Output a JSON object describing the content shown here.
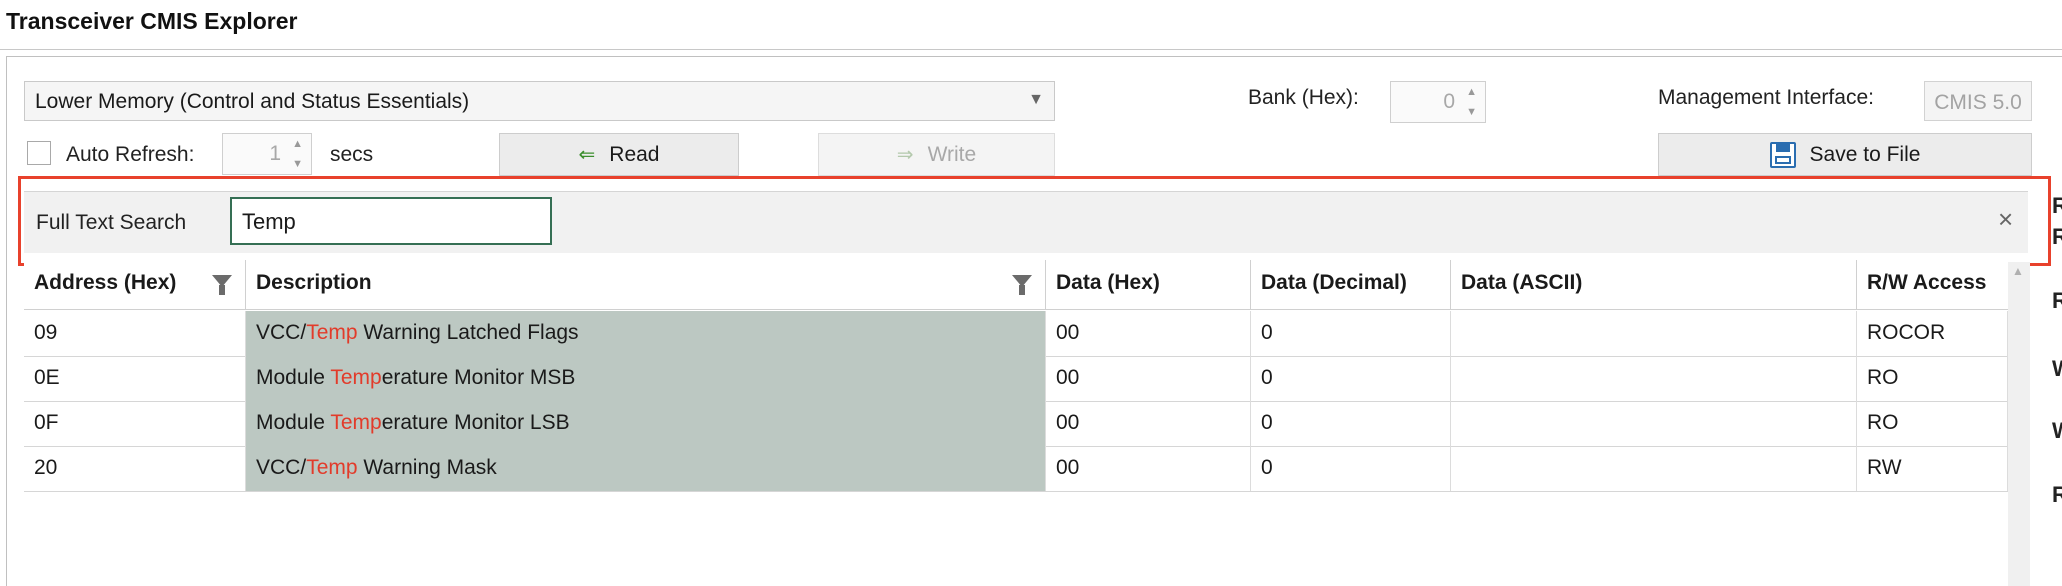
{
  "window": {
    "title": "Transceiver CMIS Explorer"
  },
  "toolbar": {
    "memory_select": "Lower Memory (Control and Status Essentials)",
    "bank_label": "Bank (Hex):",
    "bank_value": "0",
    "mgmt_label": "Management Interface:",
    "mgmt_value": "CMIS 5.0",
    "auto_refresh_label": "Auto Refresh:",
    "auto_refresh_value": "1",
    "secs_label": "secs",
    "read_label": "Read",
    "write_label": "Write",
    "save_label": "Save to File"
  },
  "search": {
    "label": "Full Text Search",
    "value": "Temp",
    "close_glyph": "×"
  },
  "grid": {
    "columns": [
      "Address (Hex)",
      "Description",
      "Data (Hex)",
      "Data (Decimal)",
      "Data (ASCII)",
      "R/W Access"
    ],
    "rows": [
      {
        "address": "09",
        "desc_pre": "VCC/",
        "desc_hit": "Temp",
        "desc_post": " Warning Latched Flags",
        "hex": "00",
        "dec": "0",
        "ascii": "",
        "rw": "ROCOR"
      },
      {
        "address": "0E",
        "desc_pre": "Module ",
        "desc_hit": "Temp",
        "desc_post": "erature Monitor MSB",
        "hex": "00",
        "dec": "0",
        "ascii": "",
        "rw": "RO"
      },
      {
        "address": "0F",
        "desc_pre": "Module ",
        "desc_hit": "Temp",
        "desc_post": "erature Monitor LSB",
        "hex": "00",
        "dec": "0",
        "ascii": "",
        "rw": "RO"
      },
      {
        "address": "20",
        "desc_pre": "VCC/",
        "desc_hit": "Temp",
        "desc_post": " Warning Mask",
        "hex": "00",
        "dec": "0",
        "ascii": "",
        "rw": "RW"
      }
    ]
  },
  "side_panel": {
    "letters": [
      "R",
      "R",
      "R",
      "W",
      "W",
      "R"
    ]
  },
  "colors": {
    "highlight_border": "#e8412c",
    "match_text": "#e23b2a",
    "desc_bg": "#bcc8c2"
  }
}
